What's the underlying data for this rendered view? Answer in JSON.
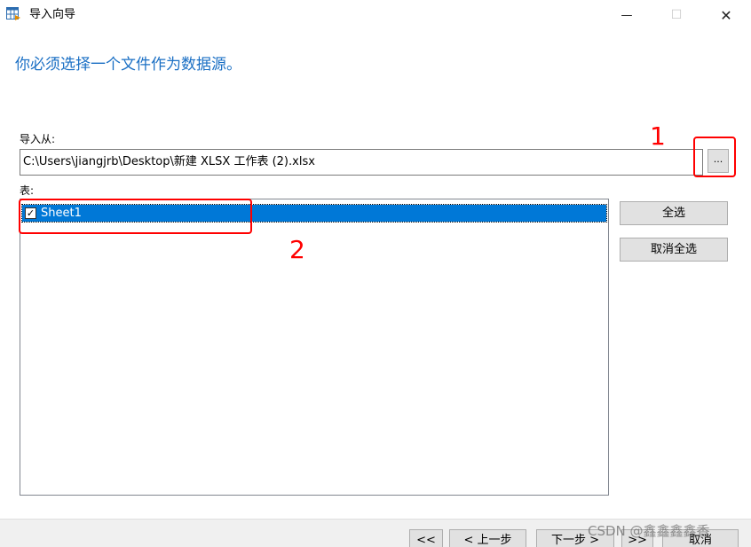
{
  "window": {
    "title": "导入向导",
    "controls": {
      "minimize": "—",
      "maximize": "☐",
      "close": "✕"
    }
  },
  "heading": "你必须选择一个文件作为数据源。",
  "import_from": {
    "label": "导入从:",
    "value": "C:\\Users\\jiangjrb\\Desktop\\新建 XLSX 工作表 (2).xlsx",
    "browse_label": "..."
  },
  "tables": {
    "label": "表:",
    "items": [
      {
        "label": "Sheet1",
        "checked": true,
        "selected": true
      }
    ],
    "select_all": "全选",
    "deselect_all": "取消全选"
  },
  "annotations": [
    {
      "number": "1",
      "color": "#ff0000"
    },
    {
      "number": "2",
      "color": "#ff0000"
    }
  ],
  "footer": {
    "first": "<<",
    "prev": "< 上一步",
    "next": "下一步 >",
    "last": ">>",
    "cancel": "取消"
  },
  "watermark": "CSDN @鑫鑫鑫鑫香",
  "colors": {
    "heading": "#1a6fc4",
    "selection": "#0078d7",
    "annotation": "#ff0000"
  }
}
